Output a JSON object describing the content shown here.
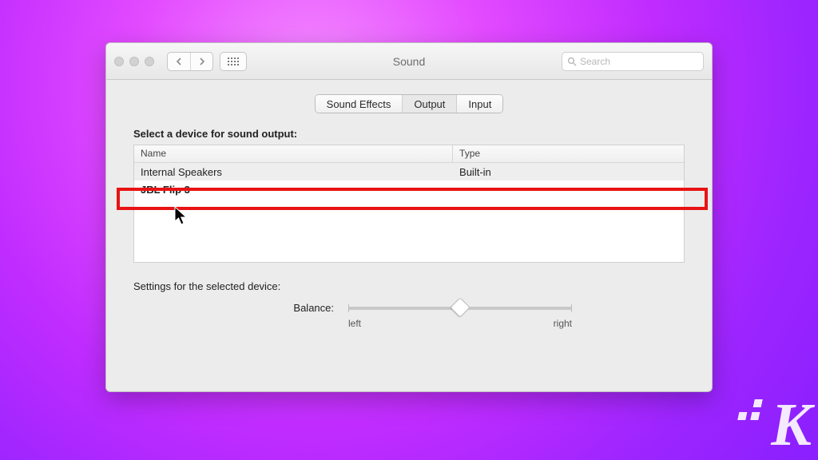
{
  "window": {
    "title": "Sound"
  },
  "search": {
    "placeholder": "Search"
  },
  "tabs": [
    {
      "label": "Sound Effects",
      "active": false
    },
    {
      "label": "Output",
      "active": true
    },
    {
      "label": "Input",
      "active": false
    }
  ],
  "output": {
    "heading": "Select a device for sound output:",
    "columns": {
      "name": "Name",
      "type": "Type"
    },
    "devices": [
      {
        "name": "Internal Speakers",
        "type": "Built-in"
      },
      {
        "name": "JBL Flip 3",
        "type": ""
      }
    ]
  },
  "settings": {
    "heading": "Settings for the selected device:",
    "balance": {
      "label": "Balance:",
      "left": "left",
      "right": "right",
      "value": 0.5
    }
  },
  "annotation": {
    "highlight_color": "#e81313"
  },
  "watermark": {
    "letter": "K"
  }
}
